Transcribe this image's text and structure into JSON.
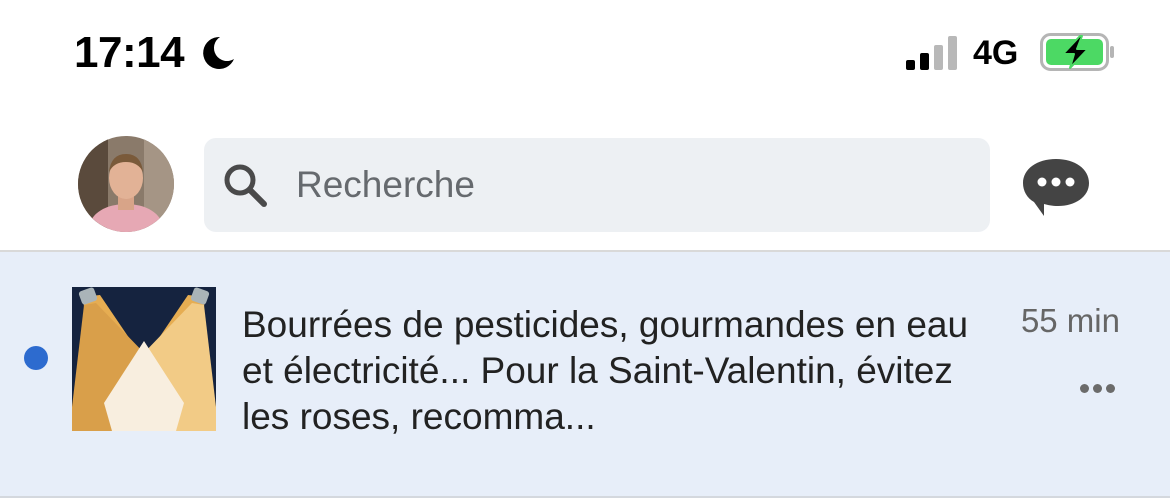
{
  "status_bar": {
    "time": "17:14",
    "moon_icon": "moon-icon",
    "signal_icon": "cellular-signal-icon",
    "network": "4G",
    "battery_icon": "battery-charging-icon",
    "battery_color": "#4cd964"
  },
  "header": {
    "avatar_icon": "profile-avatar",
    "search": {
      "placeholder": "Recherche",
      "icon": "search-icon"
    },
    "messages_icon": "messages-icon"
  },
  "notification": {
    "unread": true,
    "unread_color": "#2d6bcf",
    "thumbnail_icon": "article-thumbnail-spotlights",
    "text": "Bourrées de pesticides, gourmandes en eau et électricité... Pour la Saint-Valentin, évitez les roses, recomma...",
    "time_ago": "55 min",
    "more_icon": "more-options-icon",
    "background": "#e7eef9"
  }
}
